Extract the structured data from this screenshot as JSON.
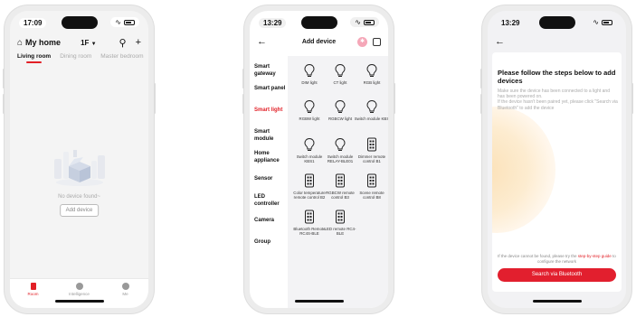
{
  "screen1": {
    "time": "17:09",
    "home_title": "My home",
    "floor": "1F",
    "rooms": [
      "Living room",
      "Dining room",
      "Master bedroom"
    ],
    "empty_text": "No device found~",
    "add_device_label": "Add device",
    "tabbar": [
      "Room",
      "Intelligence",
      "Me"
    ]
  },
  "screen2": {
    "time": "13:29",
    "title": "Add device",
    "categories": [
      "Smart gateway",
      "Smart panel",
      "Smart light",
      "Smart module",
      "Home appliance",
      "Sensor",
      "LED controller",
      "Camera",
      "Group"
    ],
    "active_category": "Smart light",
    "devices": [
      {
        "name": "DIM light",
        "icon": "bulb-icon"
      },
      {
        "name": "CT light",
        "icon": "bulb-icon"
      },
      {
        "name": "RGB light",
        "icon": "bulb-icon"
      },
      {
        "name": "RGBW light",
        "icon": "bulb-icon"
      },
      {
        "name": "RGBCW light",
        "icon": "bulb-icon"
      },
      {
        "name": "Switch module KBS",
        "icon": "bulb-icon"
      },
      {
        "name": "Switch module KBS1",
        "icon": "bulb-icon"
      },
      {
        "name": "Switch module RELAY-BLE01",
        "icon": "bulb-icon"
      },
      {
        "name": "Dimmer remote control B1",
        "icon": "remote-icon"
      },
      {
        "name": "Color temperature remote control B2",
        "icon": "remote-icon"
      },
      {
        "name": "RGBCW remote control B3",
        "icon": "remote-icon"
      },
      {
        "name": "Scene remote control B8",
        "icon": "remote-icon"
      },
      {
        "name": "Bluetooth Remote RC4S-BLE",
        "icon": "remote-icon"
      },
      {
        "name": "LED remote RC4-BLE",
        "icon": "remote-icon"
      }
    ]
  },
  "screen3": {
    "time": "13:29",
    "heading": "Please follow the steps below to add devices",
    "desc_1": "Make sure the device has been connected to a light and has been powered on.",
    "desc_2": "If the device hasn't been paired yet, please click \"Search via Bluetooth\" to add the device",
    "foot_prefix": "If the device cannot be found, please try the",
    "foot_link": "step-by-step guide",
    "foot_suffix": "to configure the network",
    "search_button": "Search via Bluetooth"
  },
  "colors": {
    "accent": "#e21f26",
    "button": "#e21f2e"
  }
}
